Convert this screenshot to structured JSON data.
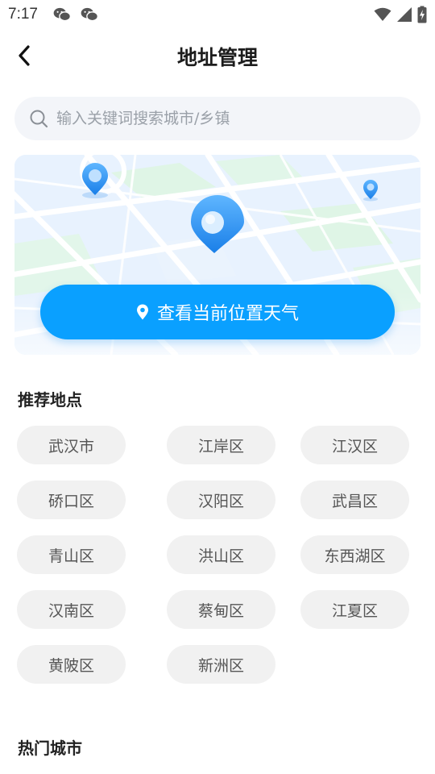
{
  "status_bar": {
    "time": "7:17",
    "app_icons": [
      "wechat-icon",
      "wechat-icon"
    ],
    "system_icons": [
      "wifi-icon",
      "signal-icon",
      "battery-charging-icon"
    ]
  },
  "header": {
    "title": "地址管理",
    "back_icon": "chevron-left-icon"
  },
  "search": {
    "placeholder": "输入关键词搜索城市/乡镇",
    "value": ""
  },
  "map_card": {
    "button_label": "查看当前位置天气",
    "button_icon": "location-pin-icon",
    "accent_color": "#0aa0ff"
  },
  "recommended": {
    "title": "推荐地点",
    "items": [
      "武汉市",
      "江岸区",
      "江汉区",
      "硚口区",
      "汉阳区",
      "武昌区",
      "青山区",
      "洪山区",
      "东西湖区",
      "汉南区",
      "蔡甸区",
      "江夏区",
      "黄陂区",
      "新洲区"
    ]
  },
  "hot_cities": {
    "title": "热门城市"
  }
}
